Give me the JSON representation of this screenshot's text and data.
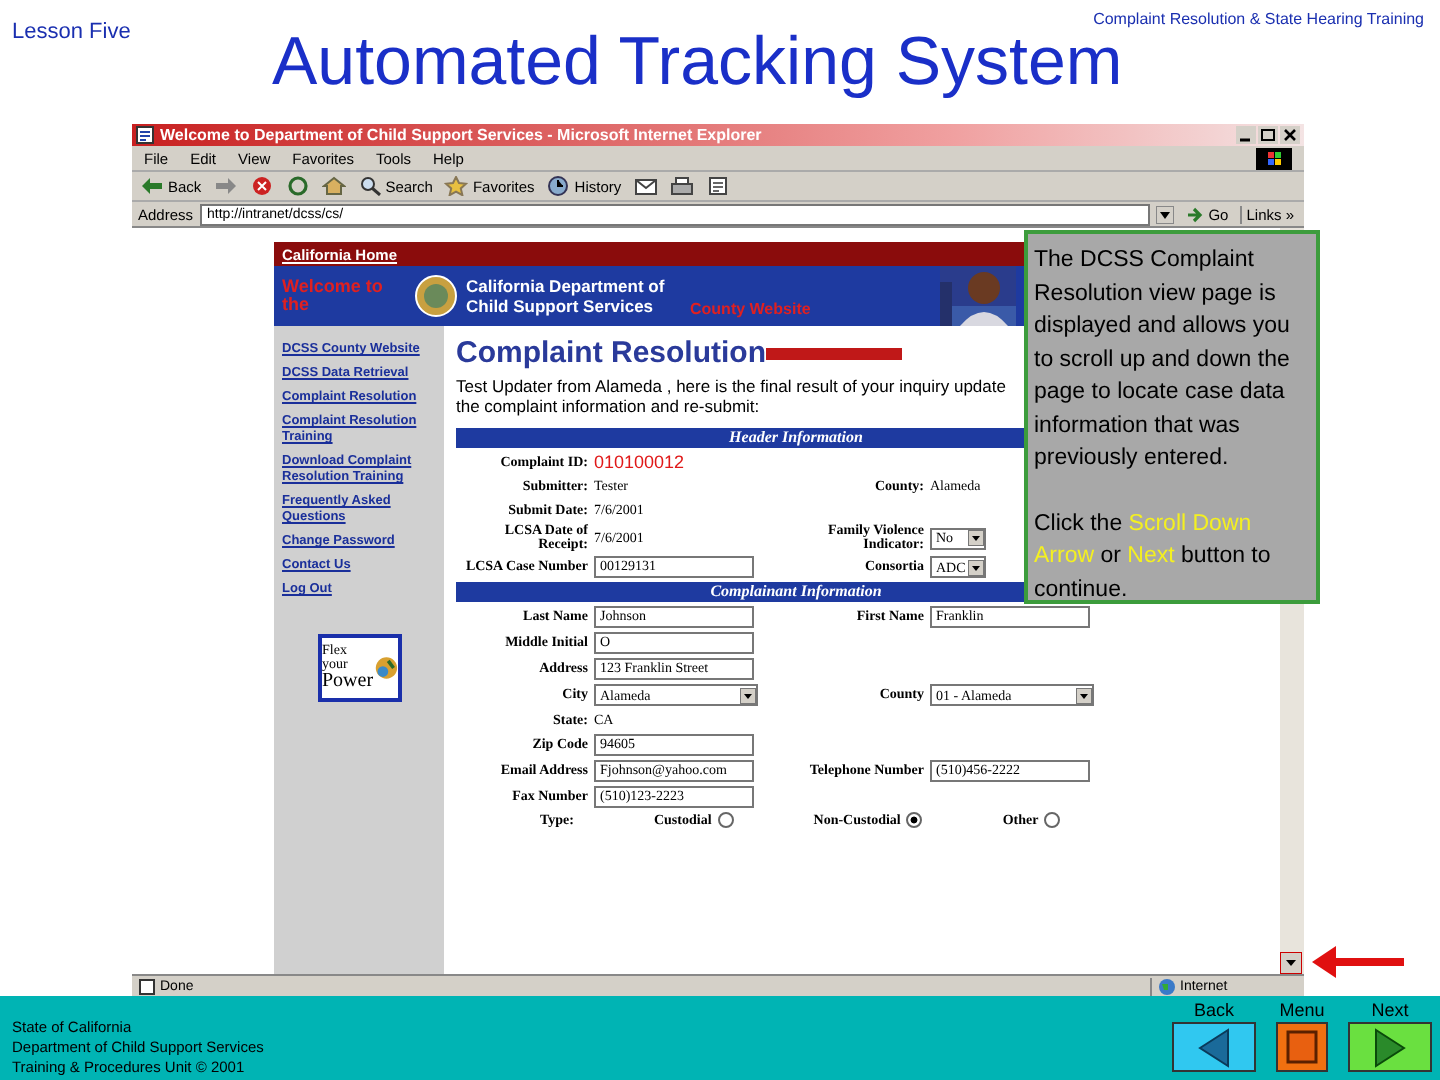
{
  "slide": {
    "lesson": "Lesson Five",
    "course": "Complaint Resolution & State Hearing Training",
    "title": "Automated Tracking System"
  },
  "browser": {
    "title": "Welcome to Department of Child Support Services - Microsoft Internet Explorer",
    "menu": [
      "File",
      "Edit",
      "View",
      "Favorites",
      "Tools",
      "Help"
    ],
    "toolbar": [
      {
        "kind": "back",
        "label": "Back"
      },
      {
        "kind": "forward"
      },
      {
        "kind": "stop"
      },
      {
        "kind": "refresh"
      },
      {
        "kind": "home"
      },
      {
        "kind": "search",
        "label": "Search"
      },
      {
        "kind": "favorites",
        "label": "Favorites"
      },
      {
        "kind": "history",
        "label": "History"
      },
      {
        "kind": "mail"
      },
      {
        "kind": "print"
      },
      {
        "kind": "edit"
      }
    ],
    "address_label": "Address",
    "address": "http://intranet/dcss/cs/",
    "go": "Go",
    "links": "Links »",
    "status": "Done",
    "zone": "Internet"
  },
  "site": {
    "top_link": "California Home",
    "welcome": "Welcome to the",
    "department": "California Department of Child Support Services",
    "county": "County Website",
    "nav": [
      "DCSS County Website",
      "DCSS Data Retrieval",
      "Complaint Resolution",
      "Complaint Resolution Training",
      "Download Complaint Resolution Training",
      "Frequently Asked Questions",
      "Change Password",
      "Contact Us",
      "Log Out"
    ],
    "badge": [
      "Flex",
      "your",
      "Power"
    ],
    "heading": "Complaint Resolution",
    "intro": "Test Updater from Alameda , here is the final result of your inquiry update the complaint information and re-submit:",
    "sections": [
      {
        "title": "Header Information",
        "rows": [
          {
            "kind": "fields",
            "cells": [
              {
                "label": "Complaint ID:",
                "value": "010100012",
                "kind": "id"
              }
            ]
          },
          {
            "kind": "fields",
            "cells": [
              {
                "label": "Submitter:",
                "value": "Tester",
                "kind": "static"
              },
              {
                "label": "County:",
                "value": "Alameda",
                "kind": "static"
              }
            ]
          },
          {
            "kind": "fields",
            "cells": [
              {
                "label": "Submit Date:",
                "value": "7/6/2001",
                "kind": "static"
              }
            ]
          },
          {
            "kind": "fields",
            "cells": [
              {
                "label": "LCSA Date of Receipt:",
                "value": "7/6/2001",
                "kind": "static"
              },
              {
                "label": "Family Violence Indicator:",
                "value": "No",
                "kind": "select"
              }
            ]
          },
          {
            "kind": "fields",
            "cells": [
              {
                "label": "LCSA Case Number",
                "value": "00129131",
                "kind": "text"
              },
              {
                "label": "Consortia",
                "value": "ADC",
                "kind": "select"
              }
            ]
          }
        ]
      },
      {
        "title": "Complainant Information",
        "rows": [
          {
            "kind": "fields",
            "cells": [
              {
                "label": "Last Name",
                "value": "Johnson",
                "kind": "text"
              },
              {
                "label": "First Name",
                "value": "Franklin",
                "kind": "text"
              }
            ]
          },
          {
            "kind": "fields",
            "cells": [
              {
                "label": "Middle Initial",
                "value": "O",
                "kind": "text"
              }
            ]
          },
          {
            "kind": "fields",
            "cells": [
              {
                "label": "Address",
                "value": "123 Franklin Street",
                "kind": "text"
              }
            ]
          },
          {
            "kind": "fields",
            "cells": [
              {
                "label": "City",
                "value": "Alameda",
                "kind": "select"
              },
              {
                "label": "County",
                "value": "01 - Alameda",
                "kind": "select"
              }
            ]
          },
          {
            "kind": "fields",
            "cells": [
              {
                "label": "State:",
                "value": "CA",
                "kind": "static"
              }
            ]
          },
          {
            "kind": "fields",
            "cells": [
              {
                "label": "Zip Code",
                "value": "94605",
                "kind": "text"
              }
            ]
          },
          {
            "kind": "fields",
            "cells": [
              {
                "label": "Email Address",
                "value": "Fjohnson@yahoo.com",
                "kind": "text"
              },
              {
                "label": "Telephone Number",
                "value": "(510)456-2222",
                "kind": "text"
              }
            ]
          },
          {
            "kind": "fields",
            "cells": [
              {
                "label": "Fax Number",
                "value": "(510)123-2223",
                "kind": "text"
              }
            ]
          },
          {
            "kind": "radios",
            "label": "Type:",
            "options": [
              {
                "label": "Custodial",
                "selected": false
              },
              {
                "label": "Non-Custodial",
                "selected": true
              },
              {
                "label": "Other",
                "selected": false
              }
            ]
          }
        ]
      }
    ]
  },
  "callout": {
    "text": "The DCSS Complaint Resolution view page is displayed and allows you to scroll up and down the page to locate case data information that was previously entered.",
    "instruction": [
      {
        "text": "Click the ",
        "highlight": false
      },
      {
        "text": "Scroll Down Arrow",
        "highlight": true
      },
      {
        "text": " or ",
        "highlight": false
      },
      {
        "text": "Next",
        "highlight": true
      },
      {
        "text": " button to continue.",
        "highlight": false
      }
    ]
  },
  "footer": [
    "State of California",
    "Department of Child Support Services",
    "Training & Procedures Unit  © 2001"
  ],
  "nav_buttons": [
    {
      "kind": "back",
      "label": "Back"
    },
    {
      "kind": "menu",
      "label": "Menu"
    },
    {
      "kind": "next",
      "label": "Next"
    }
  ]
}
